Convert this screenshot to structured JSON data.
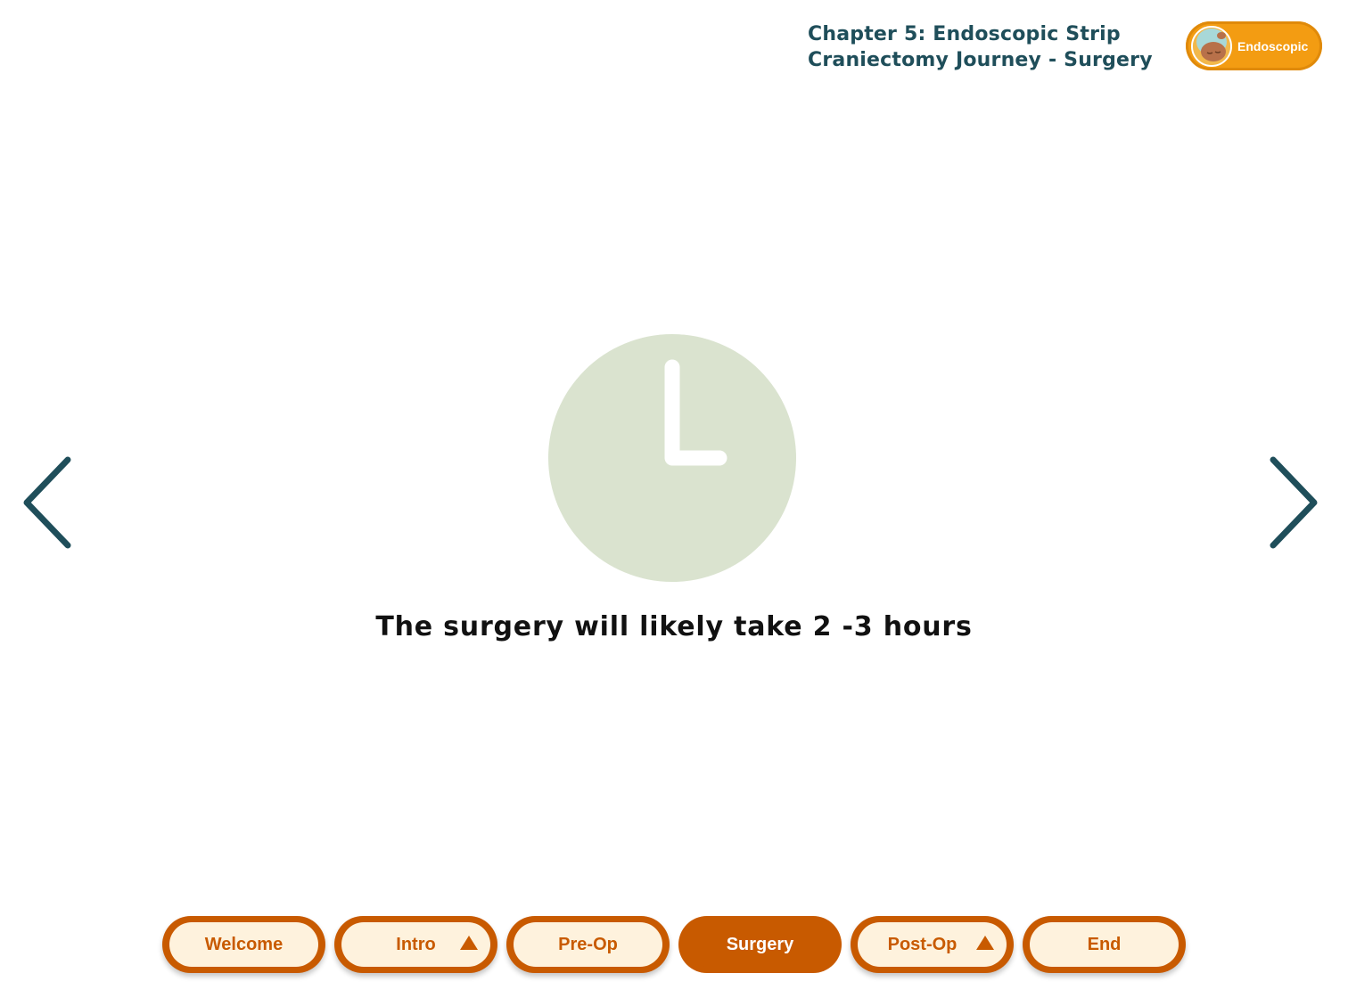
{
  "header": {
    "chapter_line1": "Chapter 5: Endoscopic Strip",
    "chapter_line2": "Craniectomy Journey -  Surgery",
    "badge_label": "Endoscopic"
  },
  "main": {
    "icon": "clock-icon",
    "caption": "The surgery will likely take 2 -3 hours"
  },
  "navigation": {
    "prev_icon": "chevron-left-icon",
    "next_icon": "chevron-right-icon"
  },
  "tabs": [
    {
      "label": "Welcome",
      "active": false,
      "has_submenu": false
    },
    {
      "label": "Intro",
      "active": false,
      "has_submenu": true
    },
    {
      "label": "Pre-Op",
      "active": false,
      "has_submenu": false
    },
    {
      "label": "Surgery",
      "active": true,
      "has_submenu": false
    },
    {
      "label": "Post-Op",
      "active": false,
      "has_submenu": true
    },
    {
      "label": "End",
      "active": false,
      "has_submenu": false
    }
  ],
  "colors": {
    "tab_orange": "#c85a00",
    "tab_fill": "#fef2dd",
    "badge_orange": "#f39c12",
    "title_teal": "#1f4e5a",
    "clock_green": "#dae3cf"
  }
}
